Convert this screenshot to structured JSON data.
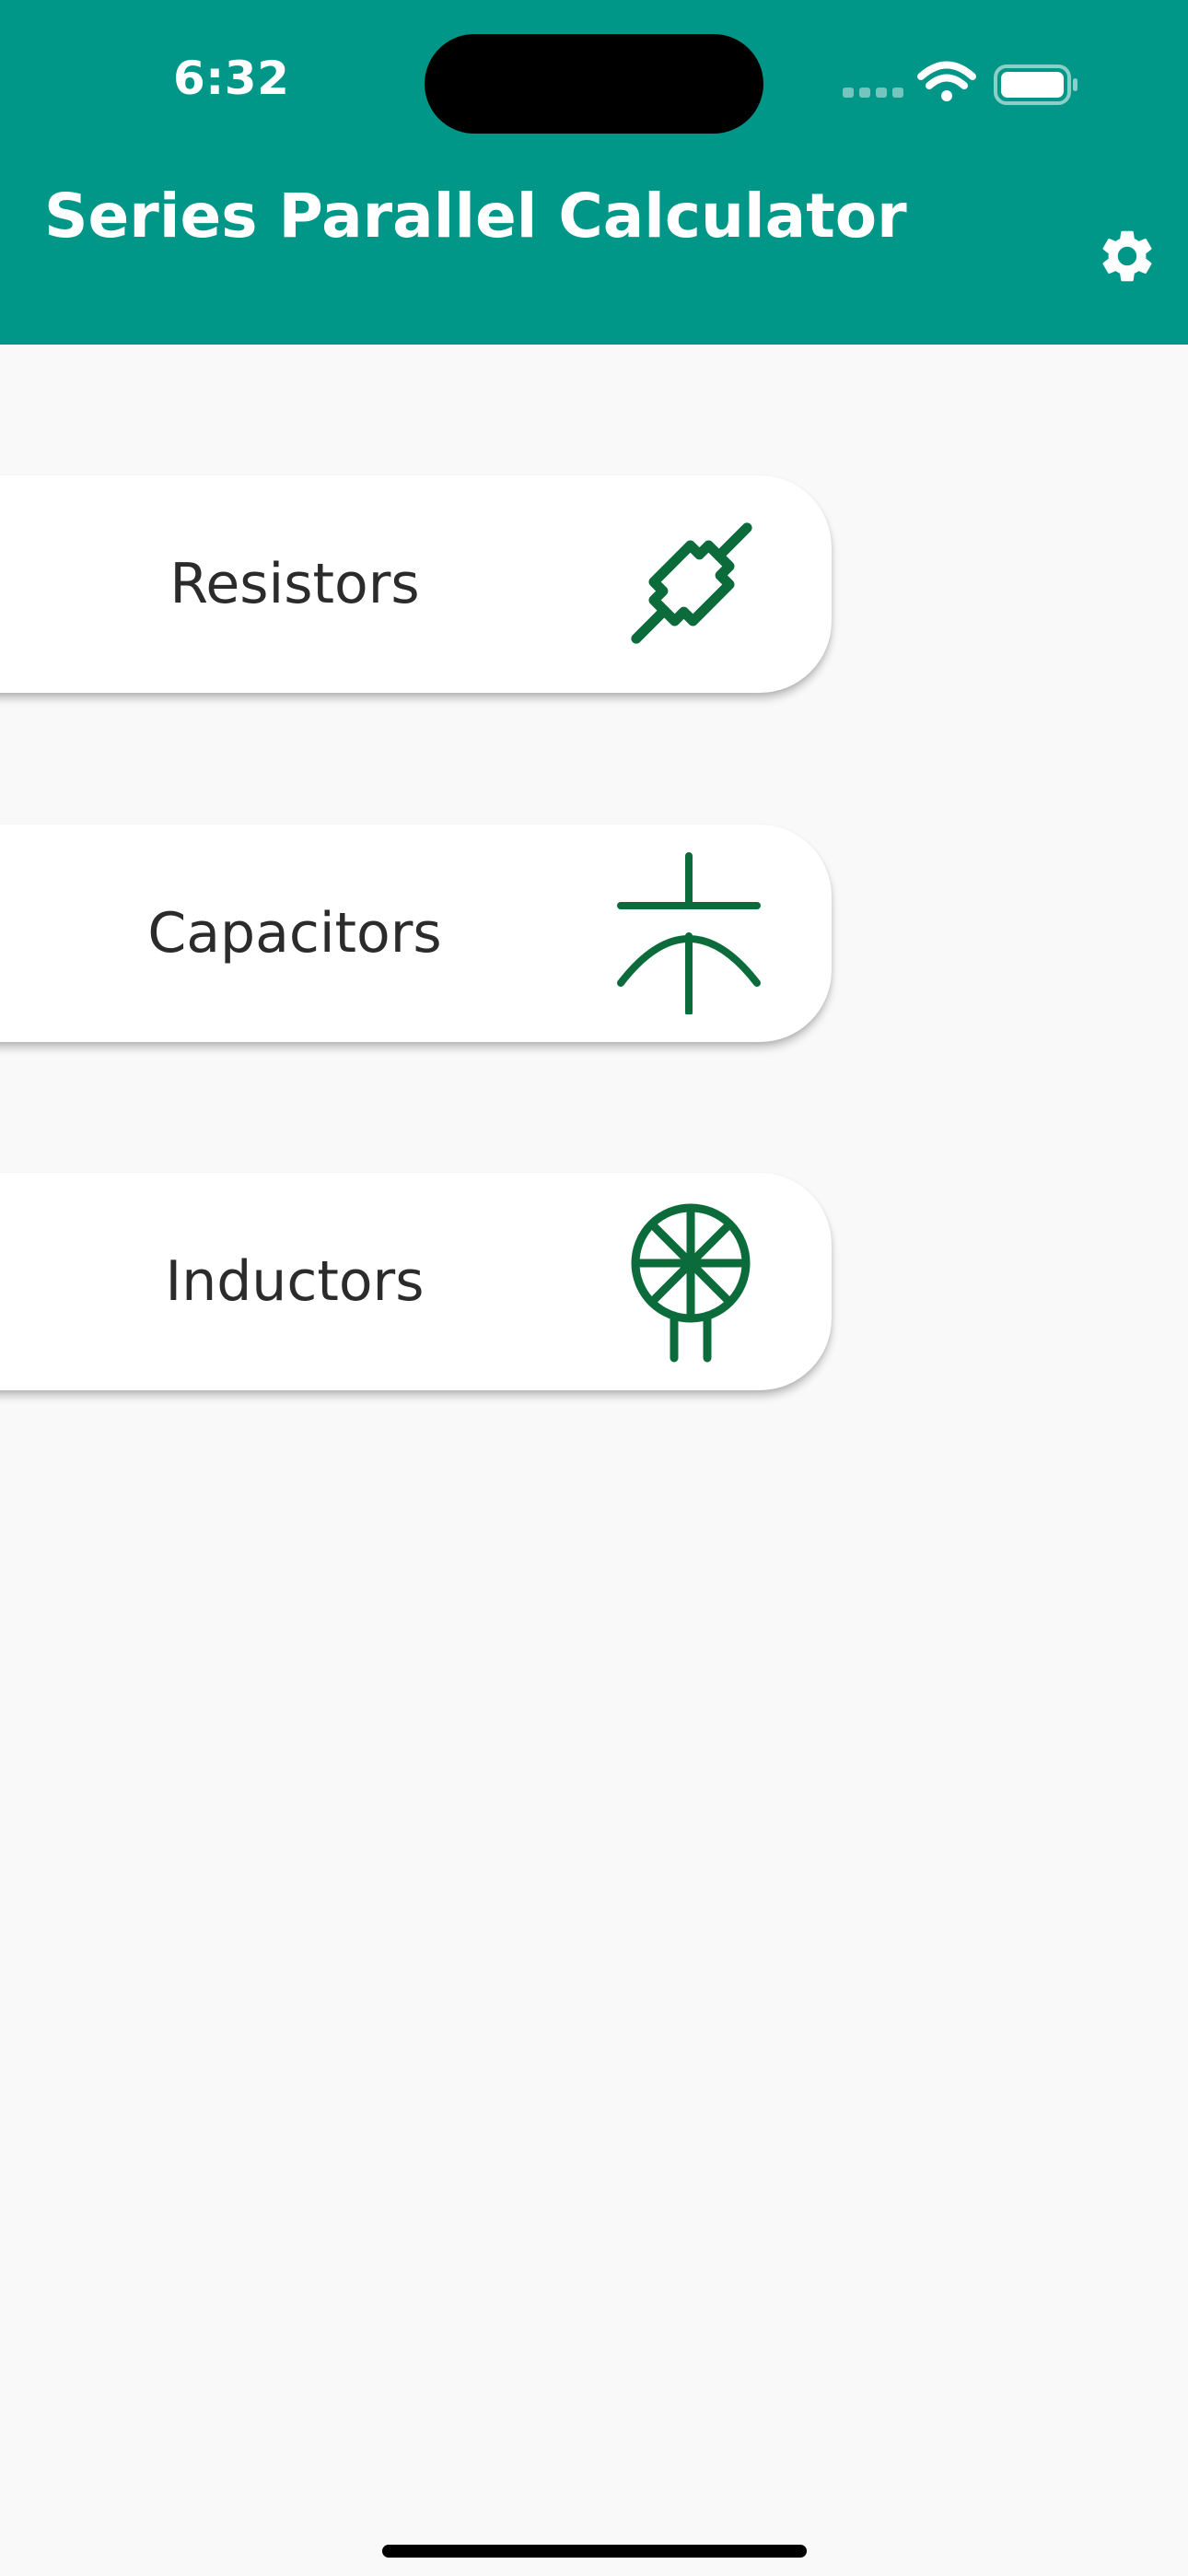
{
  "status_bar": {
    "time": "6:32",
    "icons": [
      "cellular-dots-icon",
      "wifi-icon",
      "battery-icon"
    ]
  },
  "app_bar": {
    "title": "Series Parallel Calculator",
    "background_color": "#009688",
    "settings_icon": "gear-icon"
  },
  "menu": {
    "items": [
      {
        "label": "Resistors",
        "icon": "resistor-icon"
      },
      {
        "label": "Capacitors",
        "icon": "capacitor-icon"
      },
      {
        "label": "Inductors",
        "icon": "inductor-icon"
      }
    ],
    "icon_color": "#0b6b3a"
  }
}
